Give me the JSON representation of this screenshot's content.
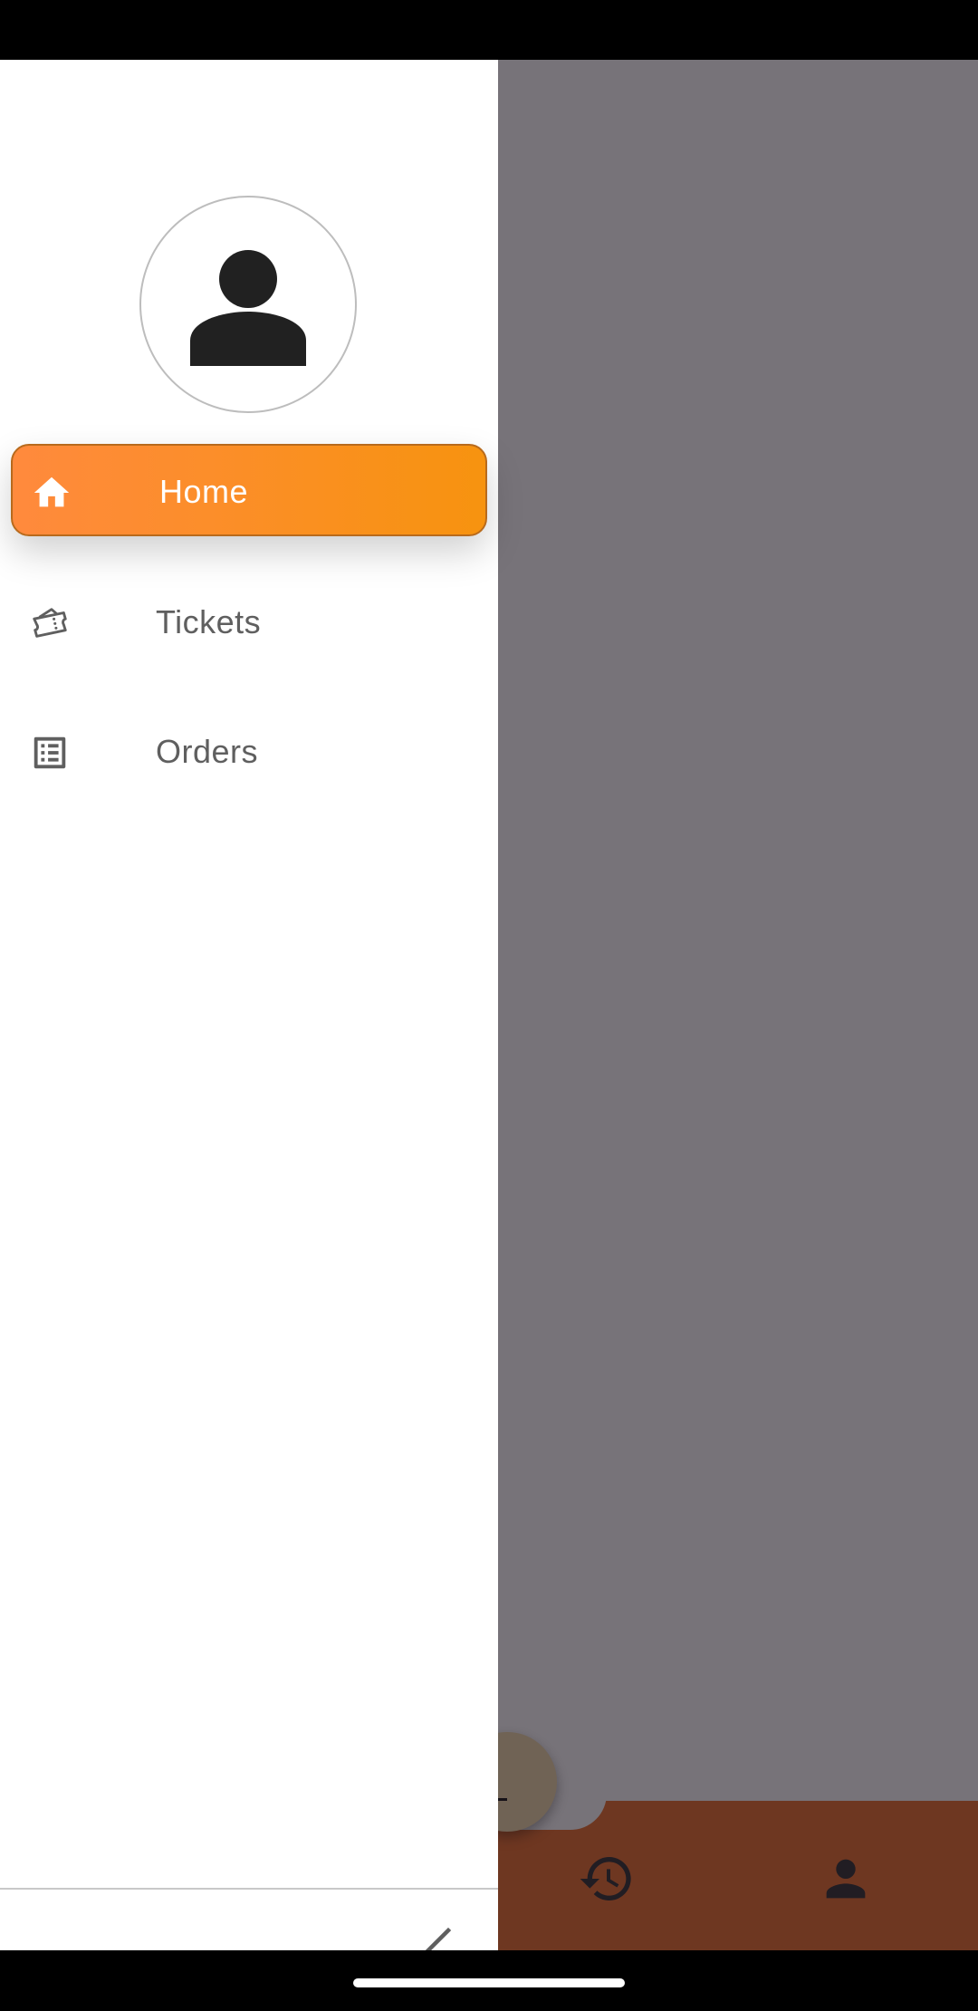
{
  "drawer": {
    "avatar_icon": "person-icon",
    "items": [
      {
        "label": "Home",
        "icon": "home-icon",
        "active": true
      },
      {
        "label": "Tickets",
        "icon": "ticket-icon",
        "active": false
      },
      {
        "label": "Orders",
        "icon": "list-icon",
        "active": false
      }
    ],
    "collapse_icon": "chevron-left-icon"
  },
  "bottom_nav": {
    "icons": [
      "history-icon",
      "person-icon"
    ]
  },
  "colors": {
    "accent_start": "#ff8a3d",
    "accent_end": "#f7930f",
    "bottom_nav": "#e9702e",
    "fab": "#efd8a9"
  }
}
